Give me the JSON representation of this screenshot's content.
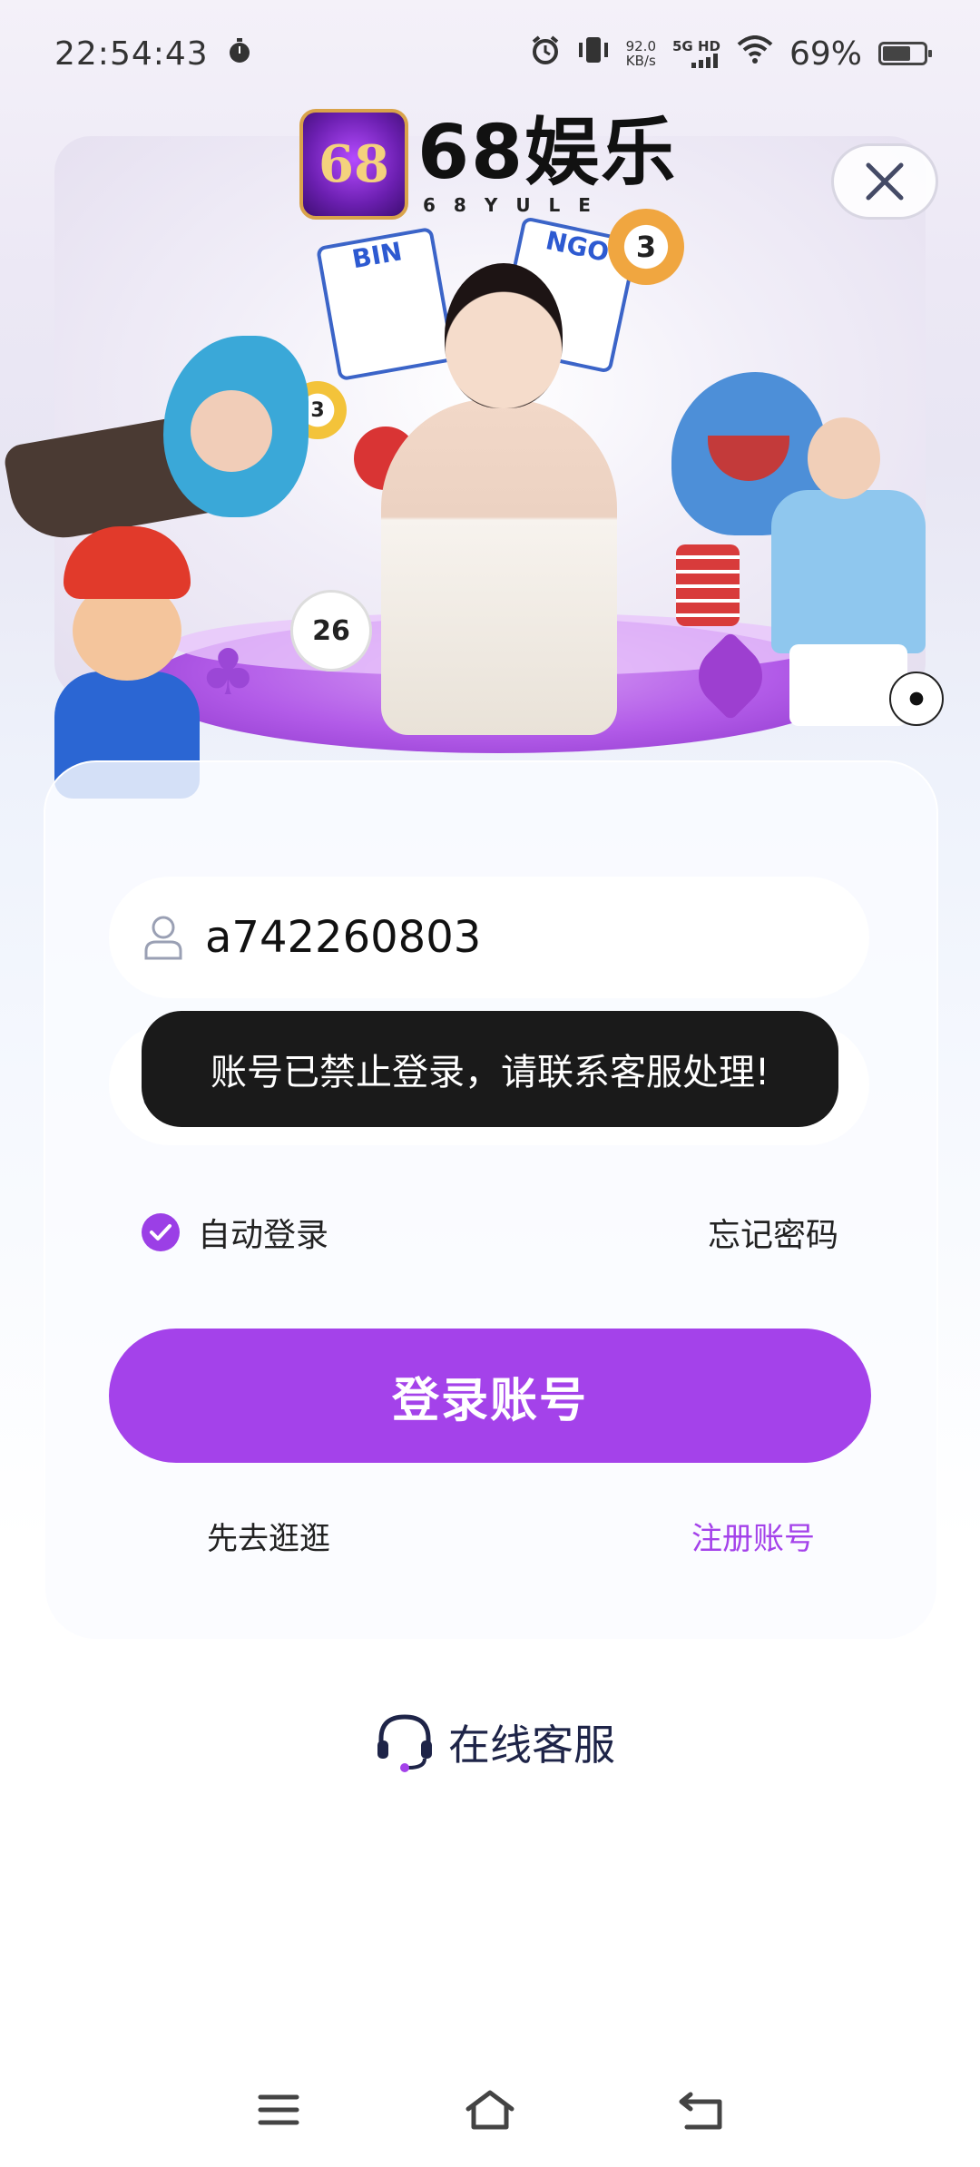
{
  "status_bar": {
    "time": "22:54:43",
    "net_speed_value": "92.0",
    "net_speed_unit": "KB/s",
    "network": "5G HD",
    "battery": "69%"
  },
  "logo": {
    "badge_text": "68",
    "title": "68娱乐",
    "subtitle": "68YULE"
  },
  "login_form": {
    "username_value": "a742260803",
    "password_value": "••••••••••••",
    "remember_label": "自动登录",
    "remember_checked": true,
    "forgot_label": "忘记密码",
    "login_button": "登录账号",
    "browse_label": "先去逛逛",
    "register_label": "注册账号"
  },
  "toast": {
    "message": "账号已禁止登录，请联系客服处理!"
  },
  "support": {
    "label": "在线客服"
  },
  "colors": {
    "accent": "#a442ea",
    "toast_bg": "#1a1a1a"
  },
  "icons": {
    "close": "close-icon",
    "user": "user-icon",
    "lock": "lock-icon",
    "check": "check-icon",
    "headset": "headset-icon",
    "alarm": "alarm-icon",
    "vibrate": "vibrate-icon",
    "wifi": "wifi-icon",
    "battery": "battery-icon",
    "timer": "timer-icon",
    "menu": "menu-icon",
    "home": "home-icon",
    "back": "back-icon"
  }
}
